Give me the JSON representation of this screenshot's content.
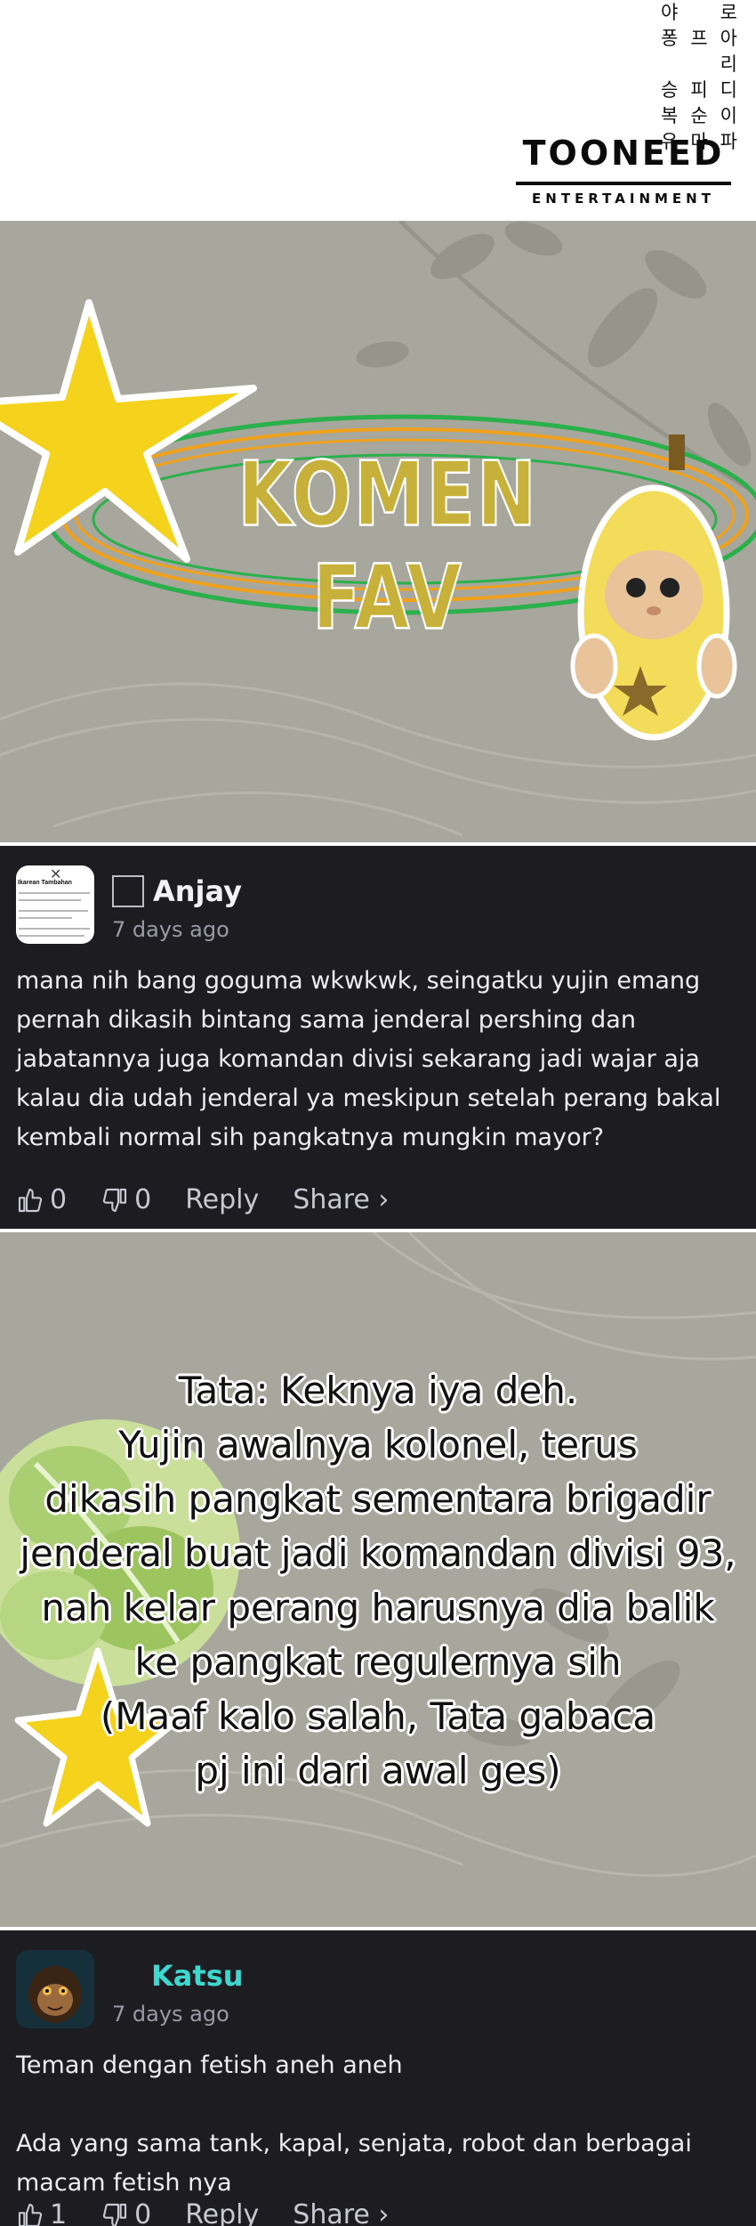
{
  "header": {
    "korean_chars": [
      "야",
      "",
      "로",
      "퐁",
      "프",
      "아리",
      "승",
      "피",
      "디",
      "복",
      "순",
      "이",
      "유",
      "마",
      "파"
    ],
    "wordmark": "TOONEED",
    "wordmark_sub": "ENTERTAINMENT"
  },
  "panel1": {
    "title": "KOMEN FAV"
  },
  "comments": [
    {
      "username": "Anjay",
      "timestamp": "7 days ago",
      "avatar_title": "Ikarean Tambahan",
      "body": "mana nih bang goguma wkwkwk, seingatku yujin emang pernah dikasih bintang sama jenderal pershing dan jabatannya juga komandan divisi sekarang jadi wajar aja kalau dia udah jenderal ya meskipun setelah perang bakal kembali normal sih pangkatnya mungkin mayor?",
      "likes": "0",
      "dislikes": "0",
      "reply_label": "Reply",
      "share_label": "Share ›"
    },
    {
      "username": "Katsu",
      "timestamp": "7 days ago",
      "body_line1": "Teman dengan fetish aneh aneh",
      "body_line2": "Ada yang sama tank, kapal, senjata, robot dan berbagai macam fetish nya",
      "likes": "1",
      "dislikes": "0",
      "reply_label": "Reply",
      "share_label": "Share ›"
    }
  ],
  "panel2": {
    "lines": [
      "Tata: Keknya iya deh.",
      "Yujin awalnya kolonel, terus",
      "dikasih pangkat sementara brigadir",
      "jenderal buat jadi komandan divisi 93,",
      "nah kelar perang harusnya dia balik",
      "ke pangkat regulernya sih",
      "(Maaf kalo salah, Tata gabaca",
      "pj ini dari awal ges)"
    ]
  },
  "colors": {
    "card_bg": "#1c1c21",
    "panel_bg": "#a7a79d",
    "star": "#f5d21c",
    "username_accent": "#3fd8d0"
  }
}
